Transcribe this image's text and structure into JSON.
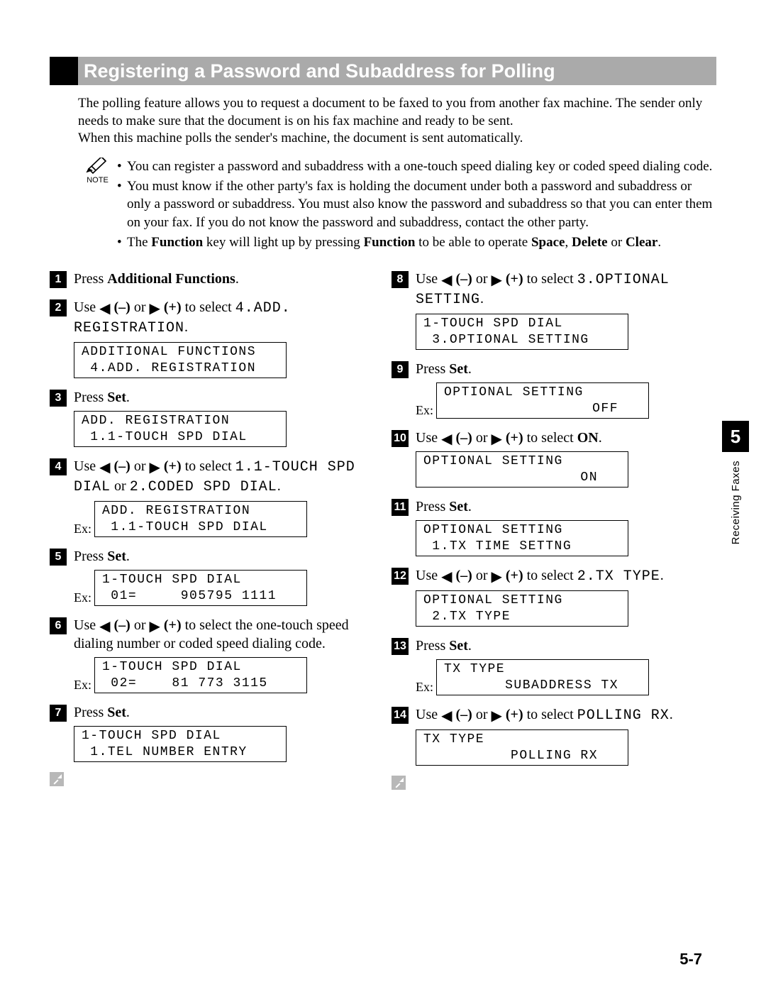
{
  "heading": "Registering a Password and Subaddress for Polling",
  "intro": "The polling feature allows you to request a document to be faxed to you from another fax machine. The sender only needs to make sure that the document is on his fax machine and ready to be sent.\nWhen this machine polls the sender's machine, the document is sent automatically.",
  "note_label": "NOTE",
  "notes": {
    "n1": "You can register a password and subaddress with a one-touch speed dialing key or coded speed dialing code.",
    "n2": "You must know if the other party's fax is holding the document under both a password and subaddress or only a password or subaddress. You must also know the password and subaddress so that you can enter them on your fax. If you do not know the password and subaddress, contact the other party.",
    "n3a": "The ",
    "n3b": "Function",
    "n3c": " key will light up by pressing ",
    "n3d": "Function",
    "n3e": " to be able to operate ",
    "n3f": "Space",
    "n3g": ", ",
    "n3h": "Delete",
    "n3i": " or ",
    "n3j": "Clear",
    "n3k": "."
  },
  "ex_label": "Ex:",
  "glyph": {
    "left": "◀",
    "right": "▶",
    "minus": "(–)",
    "plus": "(+)"
  },
  "steps": {
    "1": {
      "num": "1",
      "a": "Press ",
      "b": "Additional Functions",
      "c": "."
    },
    "2": {
      "num": "2",
      "a": "Use ",
      "b": " or ",
      "c": " to select ",
      "m": "4.ADD. REGISTRATION",
      "d": ".",
      "lcd": "ADDITIONAL FUNCTIONS\n 4.ADD. REGISTRATION"
    },
    "3": {
      "num": "3",
      "a": "Press ",
      "b": "Set",
      "c": ".",
      "lcd": "ADD. REGISTRATION\n 1.1-TOUCH SPD DIAL"
    },
    "4": {
      "num": "4",
      "a": "Use ",
      "b": " or ",
      "c": " to select ",
      "m1": "1.1-TOUCH SPD DIAL",
      "d": " or ",
      "m2": "2.CODED SPD DIAL",
      "e": ".",
      "lcd": "ADD. REGISTRATION\n 1.1-TOUCH SPD DIAL"
    },
    "5": {
      "num": "5",
      "a": "Press ",
      "b": "Set",
      "c": ".",
      "lcd": "1-TOUCH SPD DIAL\n 01=     905795 1111"
    },
    "6": {
      "num": "6",
      "a": "Use ",
      "b": " or ",
      "c": " to select the one-touch speed dialing number or coded speed dialing code.",
      "lcd": "1-TOUCH SPD DIAL\n 02=    81 773 3115"
    },
    "7": {
      "num": "7",
      "a": "Press ",
      "b": "Set",
      "c": ".",
      "lcd": "1-TOUCH SPD DIAL\n 1.TEL NUMBER ENTRY"
    },
    "8": {
      "num": "8",
      "a": "Use ",
      "b": " or ",
      "c": " to select ",
      "m": "3.OPTIONAL SETTING",
      "d": ".",
      "lcd": "1-TOUCH SPD DIAL\n 3.OPTIONAL SETTING"
    },
    "9": {
      "num": "9",
      "a": "Press ",
      "b": "Set",
      "c": ".",
      "lcd": "OPTIONAL SETTING\n                 OFF"
    },
    "10": {
      "num": "10",
      "a": "Use ",
      "b": " or ",
      "c": " to select ",
      "d": "ON",
      "e": ".",
      "lcd": "OPTIONAL SETTING\n                  ON"
    },
    "11": {
      "num": "11",
      "a": "Press ",
      "b": "Set",
      "c": ".",
      "lcd": "OPTIONAL SETTING\n 1.TX TIME SETTNG"
    },
    "12": {
      "num": "12",
      "a": "Use ",
      "b": " or ",
      "c": " to select ",
      "m": "2.TX TYPE",
      "d": ".",
      "lcd": "OPTIONAL SETTING\n 2.TX TYPE"
    },
    "13": {
      "num": "13",
      "a": "Press ",
      "b": "Set",
      "c": ".",
      "lcd": "TX TYPE\n       SUBADDRESS TX"
    },
    "14": {
      "num": "14",
      "a": "Use ",
      "b": " or ",
      "c": " to select ",
      "m": "POLLING RX",
      "d": ".",
      "lcd": "TX TYPE\n          POLLING RX"
    }
  },
  "side": {
    "chapter": "5",
    "label": "Receiving Faxes"
  },
  "page_number": "5-7"
}
